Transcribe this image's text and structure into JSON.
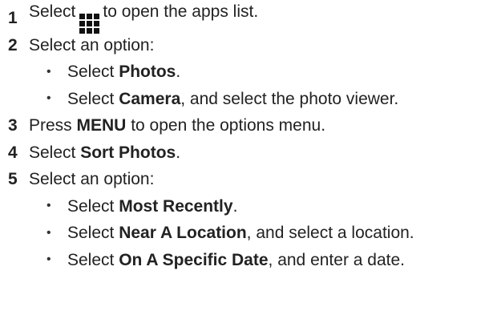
{
  "steps": [
    {
      "num": "1",
      "pre": "Select",
      "icon": "apps-grid-icon",
      "post": "to open the apps list."
    },
    {
      "num": "2",
      "text": "Select an option:",
      "subs": [
        {
          "pre": "Select ",
          "bold": "Photos",
          "post": "."
        },
        {
          "pre": "Select ",
          "bold": "Camera",
          "post": ", and select the photo viewer."
        }
      ]
    },
    {
      "num": "3",
      "pre": "Press ",
      "bold": "MENU",
      "post": " to open the options menu."
    },
    {
      "num": "4",
      "pre": "Select ",
      "bold": "Sort Photos",
      "post": "."
    },
    {
      "num": "5",
      "text": "Select an option:",
      "subs": [
        {
          "pre": "Select ",
          "bold": "Most Recently",
          "post": "."
        },
        {
          "pre": "Select ",
          "bold": "Near A Location",
          "post": ", and select a location."
        },
        {
          "pre": "Select ",
          "bold": "On A Specific Date",
          "post": ", and enter a date."
        }
      ]
    }
  ],
  "bullet": "•"
}
